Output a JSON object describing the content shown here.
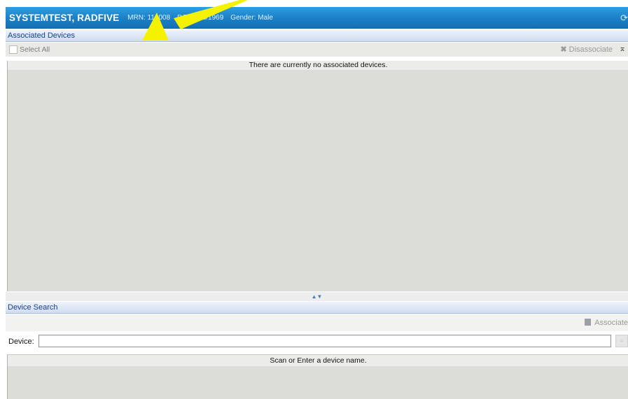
{
  "patient": {
    "name": "SYSTEMTEST, RADFIVE",
    "mrn": "MRN: 110008",
    "dob": "DOB: 8/8/1969",
    "gender": "Gender: Male"
  },
  "associated_devices": {
    "title": "Associated Devices",
    "select_all": "Select All",
    "disassociate": "Disassociate",
    "empty_message": "There are currently no associated devices."
  },
  "device_search": {
    "title": "Device Search",
    "associate": "Associate",
    "device_label": "Device:",
    "device_value": "",
    "results_message": "Scan or Enter a device name."
  },
  "icons": {
    "refresh": "refresh-icon",
    "disassociate": "puzzle-icon",
    "collapse": "collapse-icon",
    "associate": "associate-icon",
    "search": "search-icon",
    "splitter": "splitter-arrows-icon"
  },
  "colors": {
    "banner": "#1b7fc6",
    "header_text": "#1a3f8c",
    "annotation_arrow": "#f5f200"
  }
}
